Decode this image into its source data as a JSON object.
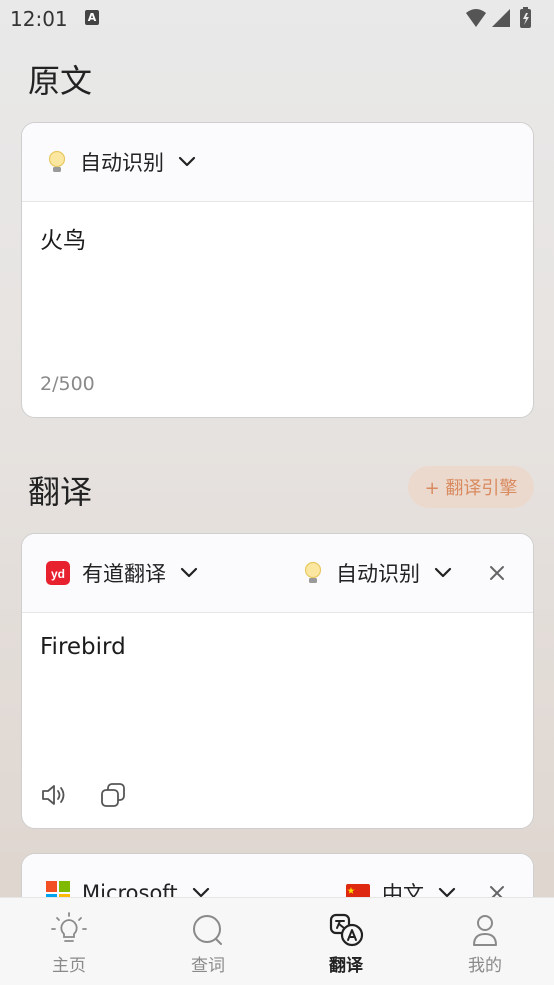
{
  "status_bar": {
    "time": "12:01",
    "notif_letter": "A"
  },
  "source": {
    "section_title": "原文",
    "language": "自动识别",
    "text": "火鸟",
    "counter": "2/500"
  },
  "translation": {
    "section_title": "翻译",
    "add_engine_label": "+ 翻译引擎",
    "results": [
      {
        "engine": "有道翻译",
        "engine_logo": "yd",
        "target_language": "自动识别",
        "text": "Firebird"
      },
      {
        "engine": "Microsoft",
        "target_language": "中文"
      }
    ]
  },
  "nav": {
    "items": [
      {
        "label": "主页",
        "icon": "lightbulb-icon"
      },
      {
        "label": "查词",
        "icon": "search-icon"
      },
      {
        "label": "翻译",
        "icon": "translate-icon",
        "active": true
      },
      {
        "label": "我的",
        "icon": "person-icon"
      }
    ]
  },
  "colors": {
    "accent": "#d98a5f",
    "youdao_red": "#e8212f",
    "text": "#1f1f1f"
  }
}
